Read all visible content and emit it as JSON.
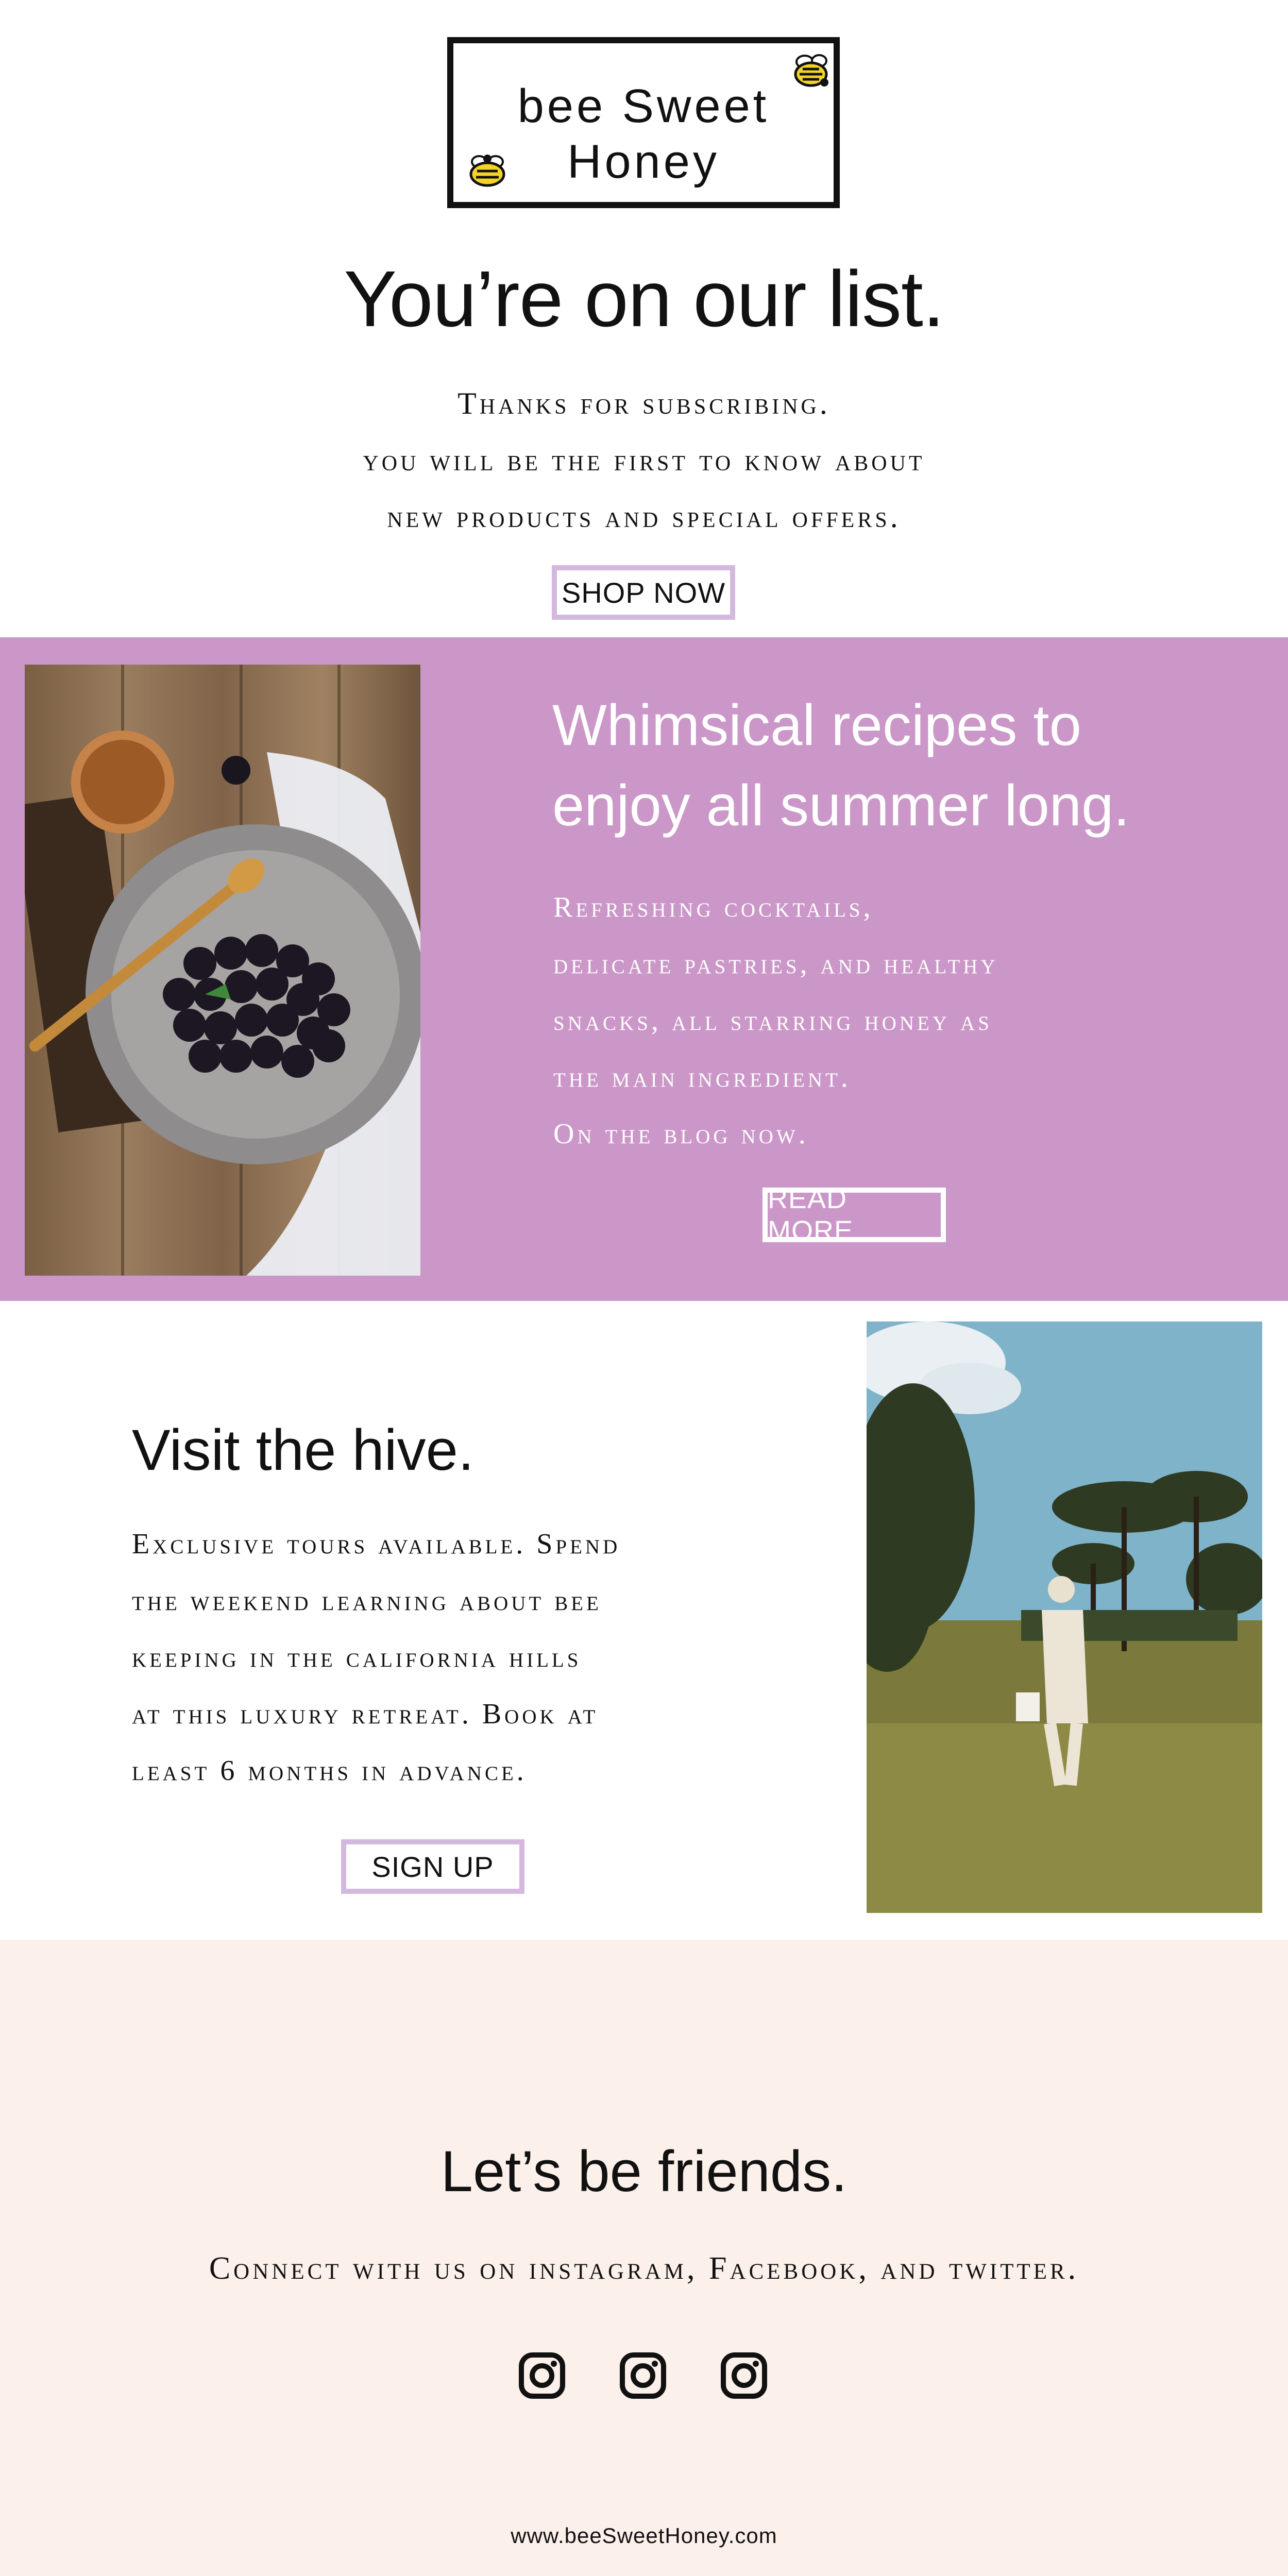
{
  "brand": {
    "logo_line1": "bee Sweet",
    "logo_line2": "Honey"
  },
  "hero": {
    "title": "You’re on our list.",
    "lines": [
      "Thanks for subscribing.",
      "you will be the first to know about",
      "new products and special offers."
    ],
    "cta_label": "SHOP NOW"
  },
  "recipes": {
    "heading_line1": "Whimsical recipes to",
    "heading_line2": "enjoy all summer long.",
    "lines": [
      "Refreshing cocktails,",
      "delicate pastries, and healthy",
      "snacks, all starring honey as",
      "the main ingredient.",
      "On the blog now."
    ],
    "cta_label": "READ MORE",
    "image_alt": "blackberries-plate-photo"
  },
  "visit": {
    "heading": "Visit the hive.",
    "lines": [
      "Exclusive tours available. Spend",
      "the weekend learning about bee",
      "keeping in the california hills",
      "at this luxury retreat. Book at",
      "least 6 months in advance."
    ],
    "cta_label": "SIGN UP",
    "image_alt": "beekeeper-field-photo"
  },
  "footer": {
    "heading": "Let’s be friends.",
    "connect_text": "Connect with us on instagram, Facebook, and twitter.",
    "social_icons": [
      "instagram-icon",
      "instagram-icon",
      "instagram-icon"
    ],
    "url": "www.beeSweetHoney.com"
  },
  "colors": {
    "purple_band": "#cb97c8",
    "button_border": "#d4b9de",
    "footer_bg": "#fcf0eb",
    "text": "#111111"
  }
}
